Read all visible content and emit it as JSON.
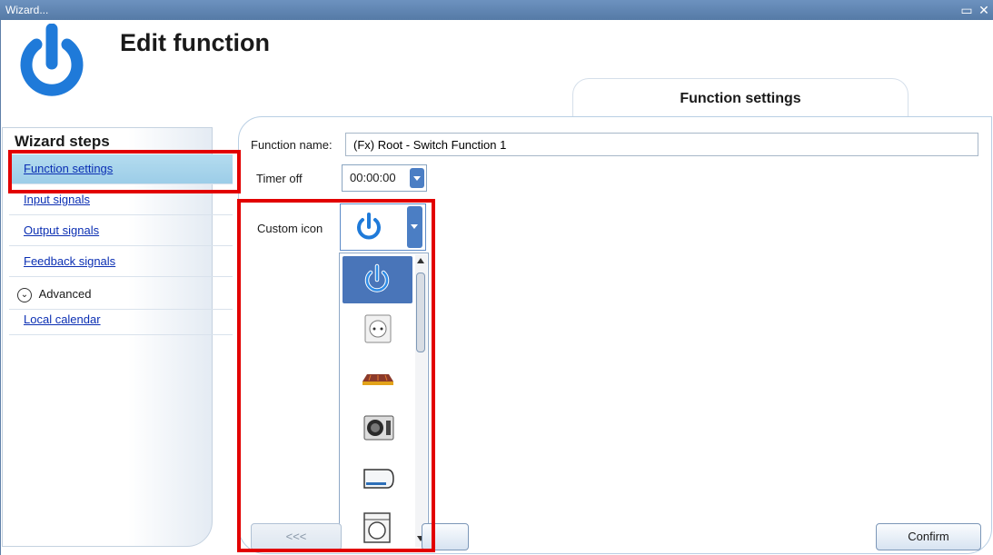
{
  "window": {
    "title": "Wizard...",
    "restore_icon": "restore-icon",
    "close_icon": "close-icon"
  },
  "header": {
    "title": "Edit function",
    "icon": "power-icon"
  },
  "tabs": [
    {
      "label": "Function settings"
    }
  ],
  "sidebar": {
    "heading": "Wizard steps",
    "items": [
      {
        "label": "Function settings",
        "active": true
      },
      {
        "label": "Input signals"
      },
      {
        "label": "Output signals"
      },
      {
        "label": "Feedback signals"
      }
    ],
    "advanced_label": "Advanced",
    "local_calendar_label": "Local calendar"
  },
  "form": {
    "function_name_label": "Function name:",
    "function_name_value": "(Fx) Root - Switch Function 1",
    "timer_off_label": "Timer off",
    "timer_off_value": "00:00:00",
    "custom_icon_label": "Custom icon",
    "custom_icon_selected": "power-icon",
    "icon_options": [
      "power-icon",
      "socket-icon",
      "heater-icon",
      "heat-pump-icon",
      "air-conditioner-icon",
      "washing-machine-icon"
    ]
  },
  "buttons": {
    "back_label": "<<<",
    "confirm_label": "Confirm"
  },
  "colors": {
    "accent": "#4975b9",
    "highlight_border": "#e20000",
    "titlebar": "#6d92bf",
    "link": "#0b2fb3",
    "power_icon": "#1f7ad9"
  }
}
